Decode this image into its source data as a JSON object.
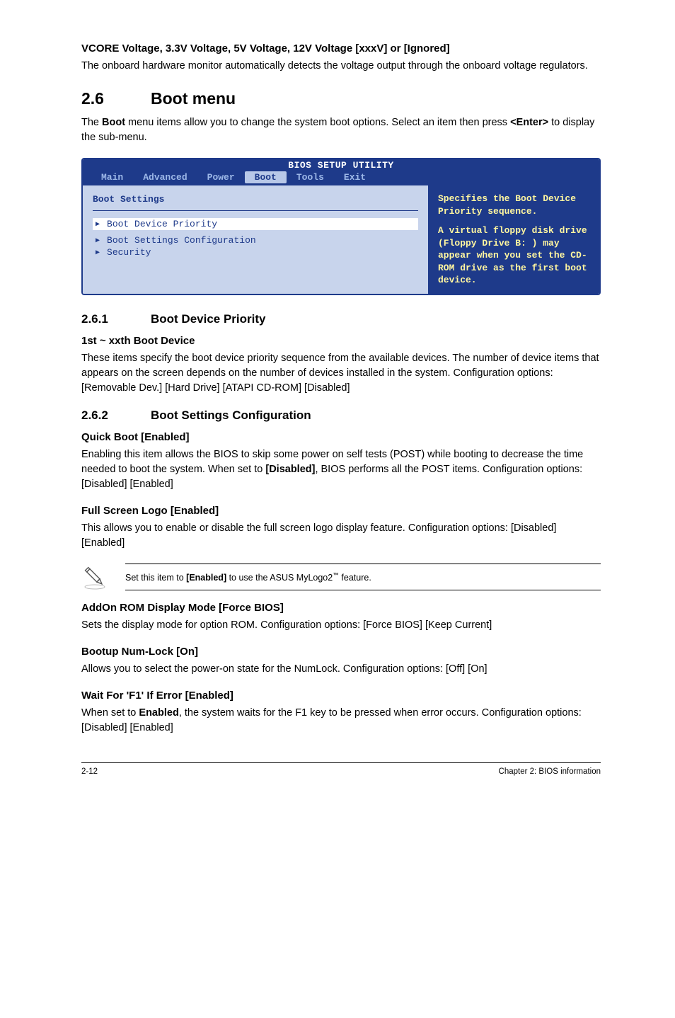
{
  "s1": {
    "heading": "VCORE Voltage, 3.3V Voltage, 5V Voltage, 12V Voltage [xxxV] or [Ignored]",
    "body": "The onboard hardware monitor automatically detects the voltage output through the onboard voltage regulators."
  },
  "s2": {
    "num": "2.6",
    "title": "Boot menu",
    "body_before_bold": "The ",
    "bold1": "Boot",
    "body_mid": " menu items allow you to change the system boot options. Select an item then press ",
    "bold2": "<Enter>",
    "body_after": " to display the sub-menu."
  },
  "bios": {
    "title": "BIOS SETUP UTILITY",
    "tabs": [
      "Main",
      "Advanced",
      "Power",
      "Boot",
      "Tools",
      "Exit"
    ],
    "panel_label": "Boot Settings",
    "items": [
      {
        "label": "Boot Device Priority",
        "selected": true
      },
      {
        "label": "Boot Settings Configuration",
        "selected": false
      },
      {
        "label": "Security",
        "selected": false
      }
    ],
    "help1": "Specifies the Boot Device Priority sequence.",
    "help2": "A virtual floppy disk drive (Floppy Drive B: ) may appear when you set the CD-ROM drive as the first boot device."
  },
  "s261": {
    "num": "2.6.1",
    "title": "Boot Device Priority",
    "sub_heading": "1st ~ xxth Boot Device",
    "body": "These items specify the boot device priority sequence from the available devices. The number of device items that appears on the screen depends on the number of devices installed in the system. Configuration options: [Removable Dev.] [Hard Drive] [ATAPI CD-ROM] [Disabled]"
  },
  "s262": {
    "num": "2.6.2",
    "title": "Boot Settings Configuration"
  },
  "quick": {
    "heading": "Quick Boot [Enabled]",
    "p1a": "Enabling this item allows the BIOS to skip some power on self tests (POST) while booting to decrease the time needed to boot the system. When set to ",
    "p1b": "[Disabled]",
    "p1c": ", BIOS performs all the POST items. Configuration options: [Disabled] [Enabled]"
  },
  "logo": {
    "heading": "Full Screen Logo [Enabled]",
    "body": "This allows you to enable or disable the full screen logo display feature. Configuration options: [Disabled] [Enabled]"
  },
  "note": {
    "a": "Set this item to ",
    "b": "[Enabled]",
    "c": " to use the ASUS MyLogo2",
    "tm": "™",
    "d": " feature."
  },
  "addon": {
    "heading": "AddOn ROM Display Mode [Force BIOS]",
    "body": "Sets the display mode for option ROM. Configuration options: [Force BIOS] [Keep Current]"
  },
  "numlock": {
    "heading": "Bootup Num-Lock [On]",
    "body": "Allows you to select the power-on state for the NumLock. Configuration options: [Off] [On]"
  },
  "f1": {
    "heading": "Wait For 'F1' If Error [Enabled]",
    "p1a": "When set to ",
    "p1b": "Enabled",
    "p1c": ", the system waits for the F1 key to be pressed when error occurs. Configuration options: [Disabled] [Enabled]"
  },
  "footer": {
    "left": "2-12",
    "right": "Chapter 2: BIOS information"
  }
}
